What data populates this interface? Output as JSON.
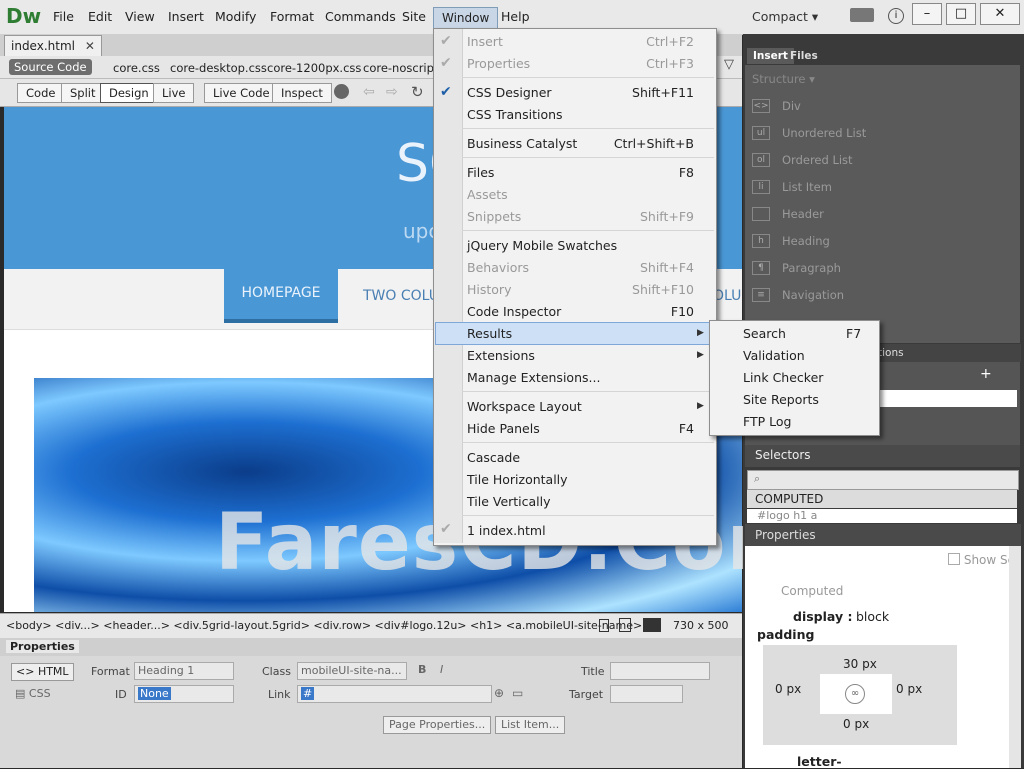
{
  "app": {
    "logo": "Dw"
  },
  "menubar": {
    "items": [
      "File",
      "Edit",
      "View",
      "Insert",
      "Modify",
      "Format",
      "Commands",
      "Site",
      "Window",
      "Help"
    ],
    "workspace": "Compact",
    "minimize": "–",
    "maximize": "□",
    "close": "✕"
  },
  "document": {
    "tab": "index.html",
    "source_code": "Source Code",
    "related_files": [
      "core.css",
      "core-desktop.css",
      "core-1200px.css",
      "core-noscript."
    ],
    "views": [
      "Code",
      "Split",
      "Design",
      "Live"
    ],
    "live_code": "Live Code",
    "inspect": "Inspect"
  },
  "design_view": {
    "site_title": "SO",
    "site_sub": "upc",
    "nav": [
      "HOMEPAGE",
      "TWO COLU",
      "OLU"
    ],
    "watermark": "FaresCD.Com"
  },
  "tagbar": {
    "tags": "<body> <div...> <header...> <div.5grid-layout.5grid> <div.row> <div#logo.12u> <h1> <a.mobileUI-site-name>",
    "window_size": "730 x 500"
  },
  "properties": {
    "title": "Properties",
    "html_btn": "HTML",
    "css_btn": "CSS",
    "format_label": "Format",
    "format_value": "Heading 1",
    "class_label": "Class",
    "class_value": "mobileUI-site-na...",
    "id_label": "ID",
    "id_value": "None",
    "link_label": "Link",
    "link_value": "#",
    "title_label": "Title",
    "target_label": "Target",
    "page_properties": "Page Properties...",
    "list_item": "List Item..."
  },
  "insert_panel": {
    "tabs": [
      "Insert",
      "Files"
    ],
    "category": "Structure",
    "items": [
      "Div",
      "Unordered List",
      "Ordered List",
      "List Item",
      "Header",
      "Heading",
      "Paragraph",
      "Navigation"
    ]
  },
  "css_panel": {
    "tab_fragment": "tions",
    "selectors": "Selectors",
    "computed": "COMPUTED",
    "selector_row": "#logo h1 a",
    "properties": "Properties",
    "show_set": "Show Set",
    "computed_label": "Computed",
    "display_key": "display :",
    "display_value": "block",
    "padding_label": "padding",
    "pad_top": "30 px",
    "pad_left": "0 px",
    "pad_right": "0 px",
    "pad_bottom": "0 px",
    "letter": "letter-"
  },
  "window_menu": {
    "items": [
      {
        "label": "Insert",
        "shortcut": "Ctrl+F2",
        "disabled": true,
        "checked": true
      },
      {
        "label": "Properties",
        "shortcut": "Ctrl+F3",
        "disabled": true,
        "checked": true
      },
      {
        "label": "CSS Designer",
        "shortcut": "Shift+F11",
        "disabled": false,
        "checked": true
      },
      {
        "label": "CSS Transitions",
        "shortcut": "",
        "disabled": false,
        "checked": false
      },
      {
        "label": "Business Catalyst",
        "shortcut": "Ctrl+Shift+B",
        "disabled": false,
        "checked": false
      },
      {
        "label": "Files",
        "shortcut": "F8",
        "disabled": false,
        "checked": false
      },
      {
        "label": "Assets",
        "shortcut": "",
        "disabled": true,
        "checked": false
      },
      {
        "label": "Snippets",
        "shortcut": "Shift+F9",
        "disabled": true,
        "checked": false
      },
      {
        "label": "jQuery Mobile Swatches",
        "shortcut": "",
        "disabled": false,
        "checked": false
      },
      {
        "label": "Behaviors",
        "shortcut": "Shift+F4",
        "disabled": true,
        "checked": false
      },
      {
        "label": "History",
        "shortcut": "Shift+F10",
        "disabled": true,
        "checked": false
      },
      {
        "label": "Code Inspector",
        "shortcut": "F10",
        "disabled": false,
        "checked": false
      },
      {
        "label": "Results",
        "shortcut": "",
        "disabled": false,
        "checked": false
      },
      {
        "label": "Extensions",
        "shortcut": "",
        "disabled": false,
        "checked": false
      },
      {
        "label": "Manage Extensions...",
        "shortcut": "",
        "disabled": false,
        "checked": false
      },
      {
        "label": "Workspace Layout",
        "shortcut": "",
        "disabled": false,
        "checked": false
      },
      {
        "label": "Hide Panels",
        "shortcut": "F4",
        "disabled": false,
        "checked": false
      },
      {
        "label": "Cascade",
        "shortcut": "",
        "disabled": false,
        "checked": false
      },
      {
        "label": "Tile Horizontally",
        "shortcut": "",
        "disabled": false,
        "checked": false
      },
      {
        "label": "Tile Vertically",
        "shortcut": "",
        "disabled": false,
        "checked": false
      },
      {
        "label": "1 index.html",
        "shortcut": "",
        "disabled": false,
        "checked": true
      }
    ]
  },
  "results_submenu": {
    "items": [
      {
        "label": "Search",
        "shortcut": "F7"
      },
      {
        "label": "Validation",
        "shortcut": ""
      },
      {
        "label": "Link Checker",
        "shortcut": ""
      },
      {
        "label": "Site Reports",
        "shortcut": ""
      },
      {
        "label": "FTP Log",
        "shortcut": ""
      }
    ]
  },
  "colors": {
    "accent": "#4a97d6",
    "menu_highlight": "#cde0f5",
    "logo": "#2e7d32"
  }
}
